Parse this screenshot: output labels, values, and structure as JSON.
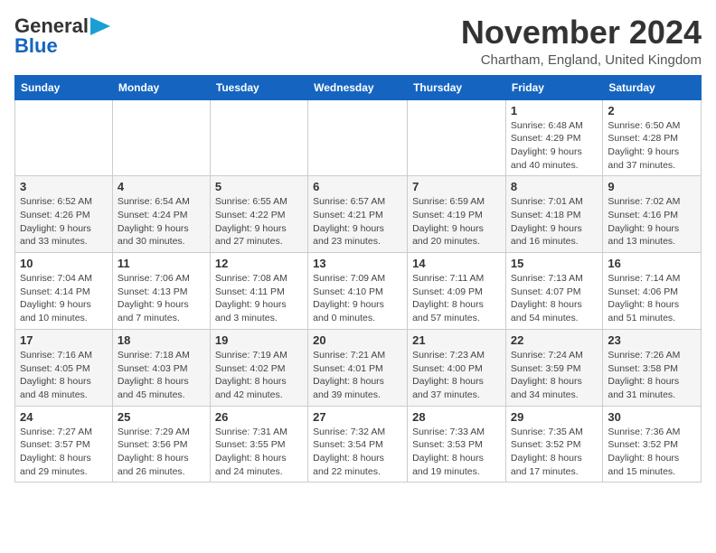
{
  "logo": {
    "line1": "General",
    "line2": "Blue",
    "arrow": "▶"
  },
  "title": "November 2024",
  "subtitle": "Chartham, England, United Kingdom",
  "headers": [
    "Sunday",
    "Monday",
    "Tuesday",
    "Wednesday",
    "Thursday",
    "Friday",
    "Saturday"
  ],
  "weeks": [
    [
      {
        "day": "",
        "info": ""
      },
      {
        "day": "",
        "info": ""
      },
      {
        "day": "",
        "info": ""
      },
      {
        "day": "",
        "info": ""
      },
      {
        "day": "",
        "info": ""
      },
      {
        "day": "1",
        "info": "Sunrise: 6:48 AM\nSunset: 4:29 PM\nDaylight: 9 hours\nand 40 minutes."
      },
      {
        "day": "2",
        "info": "Sunrise: 6:50 AM\nSunset: 4:28 PM\nDaylight: 9 hours\nand 37 minutes."
      }
    ],
    [
      {
        "day": "3",
        "info": "Sunrise: 6:52 AM\nSunset: 4:26 PM\nDaylight: 9 hours\nand 33 minutes."
      },
      {
        "day": "4",
        "info": "Sunrise: 6:54 AM\nSunset: 4:24 PM\nDaylight: 9 hours\nand 30 minutes."
      },
      {
        "day": "5",
        "info": "Sunrise: 6:55 AM\nSunset: 4:22 PM\nDaylight: 9 hours\nand 27 minutes."
      },
      {
        "day": "6",
        "info": "Sunrise: 6:57 AM\nSunset: 4:21 PM\nDaylight: 9 hours\nand 23 minutes."
      },
      {
        "day": "7",
        "info": "Sunrise: 6:59 AM\nSunset: 4:19 PM\nDaylight: 9 hours\nand 20 minutes."
      },
      {
        "day": "8",
        "info": "Sunrise: 7:01 AM\nSunset: 4:18 PM\nDaylight: 9 hours\nand 16 minutes."
      },
      {
        "day": "9",
        "info": "Sunrise: 7:02 AM\nSunset: 4:16 PM\nDaylight: 9 hours\nand 13 minutes."
      }
    ],
    [
      {
        "day": "10",
        "info": "Sunrise: 7:04 AM\nSunset: 4:14 PM\nDaylight: 9 hours\nand 10 minutes."
      },
      {
        "day": "11",
        "info": "Sunrise: 7:06 AM\nSunset: 4:13 PM\nDaylight: 9 hours\nand 7 minutes."
      },
      {
        "day": "12",
        "info": "Sunrise: 7:08 AM\nSunset: 4:11 PM\nDaylight: 9 hours\nand 3 minutes."
      },
      {
        "day": "13",
        "info": "Sunrise: 7:09 AM\nSunset: 4:10 PM\nDaylight: 9 hours\nand 0 minutes."
      },
      {
        "day": "14",
        "info": "Sunrise: 7:11 AM\nSunset: 4:09 PM\nDaylight: 8 hours\nand 57 minutes."
      },
      {
        "day": "15",
        "info": "Sunrise: 7:13 AM\nSunset: 4:07 PM\nDaylight: 8 hours\nand 54 minutes."
      },
      {
        "day": "16",
        "info": "Sunrise: 7:14 AM\nSunset: 4:06 PM\nDaylight: 8 hours\nand 51 minutes."
      }
    ],
    [
      {
        "day": "17",
        "info": "Sunrise: 7:16 AM\nSunset: 4:05 PM\nDaylight: 8 hours\nand 48 minutes."
      },
      {
        "day": "18",
        "info": "Sunrise: 7:18 AM\nSunset: 4:03 PM\nDaylight: 8 hours\nand 45 minutes."
      },
      {
        "day": "19",
        "info": "Sunrise: 7:19 AM\nSunset: 4:02 PM\nDaylight: 8 hours\nand 42 minutes."
      },
      {
        "day": "20",
        "info": "Sunrise: 7:21 AM\nSunset: 4:01 PM\nDaylight: 8 hours\nand 39 minutes."
      },
      {
        "day": "21",
        "info": "Sunrise: 7:23 AM\nSunset: 4:00 PM\nDaylight: 8 hours\nand 37 minutes."
      },
      {
        "day": "22",
        "info": "Sunrise: 7:24 AM\nSunset: 3:59 PM\nDaylight: 8 hours\nand 34 minutes."
      },
      {
        "day": "23",
        "info": "Sunrise: 7:26 AM\nSunset: 3:58 PM\nDaylight: 8 hours\nand 31 minutes."
      }
    ],
    [
      {
        "day": "24",
        "info": "Sunrise: 7:27 AM\nSunset: 3:57 PM\nDaylight: 8 hours\nand 29 minutes."
      },
      {
        "day": "25",
        "info": "Sunrise: 7:29 AM\nSunset: 3:56 PM\nDaylight: 8 hours\nand 26 minutes."
      },
      {
        "day": "26",
        "info": "Sunrise: 7:31 AM\nSunset: 3:55 PM\nDaylight: 8 hours\nand 24 minutes."
      },
      {
        "day": "27",
        "info": "Sunrise: 7:32 AM\nSunset: 3:54 PM\nDaylight: 8 hours\nand 22 minutes."
      },
      {
        "day": "28",
        "info": "Sunrise: 7:33 AM\nSunset: 3:53 PM\nDaylight: 8 hours\nand 19 minutes."
      },
      {
        "day": "29",
        "info": "Sunrise: 7:35 AM\nSunset: 3:52 PM\nDaylight: 8 hours\nand 17 minutes."
      },
      {
        "day": "30",
        "info": "Sunrise: 7:36 AM\nSunset: 3:52 PM\nDaylight: 8 hours\nand 15 minutes."
      }
    ]
  ]
}
